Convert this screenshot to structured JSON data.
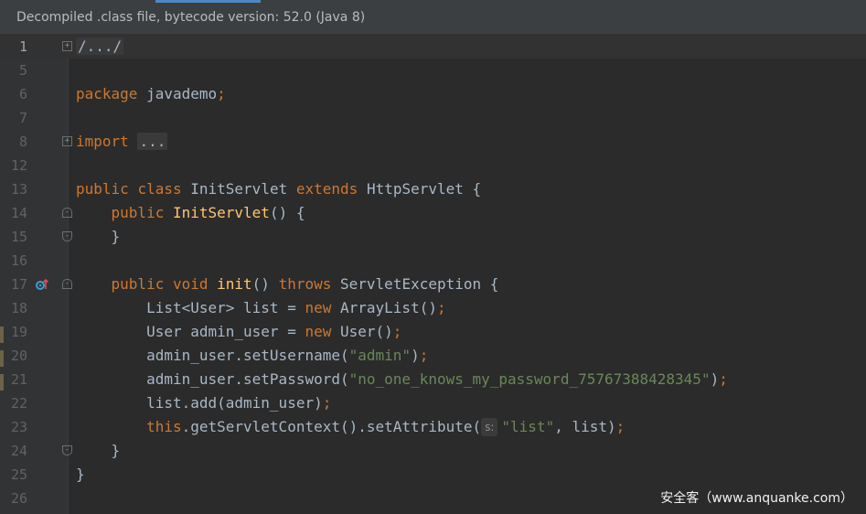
{
  "banner": {
    "text": "Decompiled .class file, bytecode version: 52.0 (Java 8)"
  },
  "icons": {
    "fold": "fold-toggle-icon",
    "implements": "overridden-method-icon"
  },
  "colors": {
    "keyword": "#cc7832",
    "method": "#ffc66d",
    "string": "#6a8759",
    "text": "#a9b7c6",
    "background": "#2b2b2b"
  },
  "lines": [
    {
      "num": "1",
      "text": "/.../"
    },
    {
      "num": "5",
      "text": ""
    },
    {
      "num": "6",
      "kw": "package",
      "rest": " javademo",
      "semi": ";"
    },
    {
      "num": "7",
      "text": ""
    },
    {
      "num": "8",
      "kw": "import",
      "folded": "..."
    },
    {
      "num": "12",
      "text": ""
    },
    {
      "num": "13",
      "kw1": "public",
      "kw2": "class",
      "name": "InitServlet",
      "kw3": "extends",
      "rest": "HttpServlet {"
    },
    {
      "num": "14",
      "kw": "public",
      "fn": "InitServlet",
      "rest": "() {"
    },
    {
      "num": "15",
      "text": "}"
    },
    {
      "num": "16",
      "text": ""
    },
    {
      "num": "17",
      "kw1": "public",
      "kw2": "void",
      "fn": "init",
      "paren": "()",
      "kw3": "throws",
      "rest": "ServletException {"
    },
    {
      "num": "18",
      "pre": "List<User> list = ",
      "kw": "new",
      "post": "ArrayList()",
      "semi": ";"
    },
    {
      "num": "19",
      "pre": "User admin_user = ",
      "kw": "new",
      "post": "User()",
      "semi": ";"
    },
    {
      "num": "20",
      "pre": "admin_user.setUsername(",
      "str": "\"admin\"",
      "post": ")",
      "semi": ";"
    },
    {
      "num": "21",
      "pre": "admin_user.setPassword(",
      "str": "\"no_one_knows_my_password_75767388428345\"",
      "post": ")",
      "semi": ";"
    },
    {
      "num": "22",
      "pre": "list.add(admin_user)",
      "semi": ";"
    },
    {
      "num": "23",
      "kw": "this",
      "pre": ".getServletContext().setAttribute(",
      "hint": "s:",
      "str": "\"list\"",
      "post": ", list)",
      "semi": ";"
    },
    {
      "num": "24",
      "text": "}"
    },
    {
      "num": "25",
      "text": "}"
    },
    {
      "num": "26",
      "text": ""
    }
  ],
  "watermark": {
    "text": "安全客（www.anquanke.com）"
  }
}
